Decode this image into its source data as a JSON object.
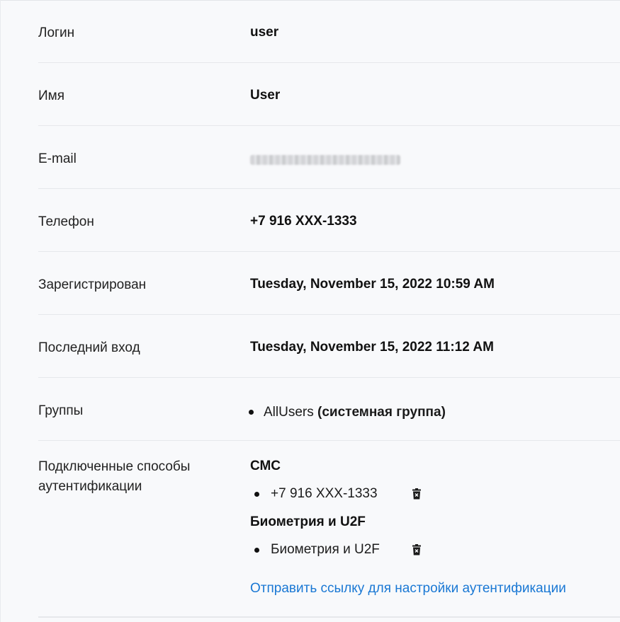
{
  "profile": {
    "rows": [
      {
        "label": "Логин",
        "value": "user"
      },
      {
        "label": "Имя",
        "value": "User"
      },
      {
        "label": "E-mail",
        "value": ""
      },
      {
        "label": "Телефон",
        "value": "+7 916 XXX-1333"
      },
      {
        "label": "Зарегистрирован",
        "value": "Tuesday, November 15, 2022 10:59 AM"
      },
      {
        "label": "Последний вход",
        "value": "Tuesday, November 15, 2022 11:12 AM"
      }
    ],
    "groups": {
      "label": "Группы",
      "items": [
        {
          "name": "AllUsers",
          "type": "(системная группа)"
        }
      ]
    },
    "auth": {
      "label": "Подключенные способы аутентификации",
      "methods": [
        {
          "title": "СМС",
          "items": [
            "+7 916 XXX-1333"
          ]
        },
        {
          "title": "Биометрия и U2F",
          "items": [
            "Биометрия и U2F"
          ]
        }
      ],
      "link_text": "Отправить ссылку для настройки аутентификации"
    }
  },
  "icons": {
    "delete": "trash-icon"
  },
  "colors": {
    "link": "#1a78d4",
    "background": "#f8f9fb",
    "divider": "#e6e8eb"
  }
}
